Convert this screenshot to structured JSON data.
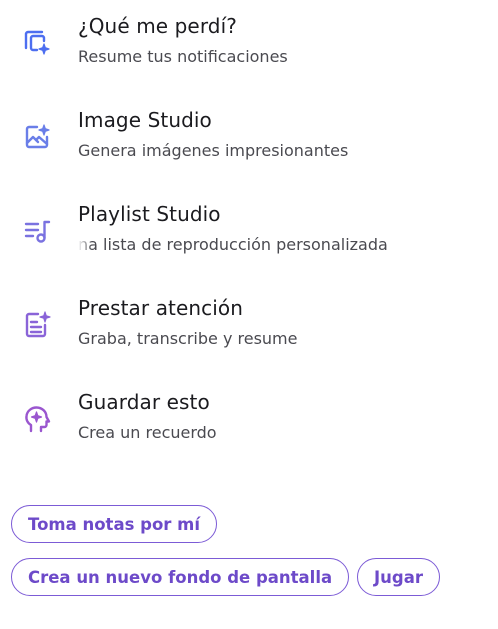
{
  "menu": {
    "items": [
      {
        "title": "¿Qué me perdí?",
        "subtitle": "Resume tus notificaciones",
        "icon": "notifications-summary-icon",
        "color": "#4d6ef0"
      },
      {
        "title": "Image Studio",
        "subtitle": "Genera imágenes impresionantes",
        "icon": "image-sparkle-icon",
        "color": "#6a7ee8"
      },
      {
        "title": "Playlist Studio",
        "subtitle": "na lista de reproducción personalizada",
        "icon": "playlist-icon",
        "color": "#7a72e0"
      },
      {
        "title": "Prestar atención",
        "subtitle": "Graba, transcribe y resume",
        "icon": "notes-sparkle-icon",
        "color": "#8a64d8"
      },
      {
        "title": "Guardar esto",
        "subtitle": "Crea un recuerdo",
        "icon": "memory-head-icon",
        "color": "#9a56cf"
      }
    ]
  },
  "suggestions": {
    "chips": [
      {
        "label": "Toma notas por mí"
      },
      {
        "label": "Crea un nuevo fondo de pantalla"
      },
      {
        "label": "Jugar"
      }
    ]
  },
  "colors": {
    "accent": "#7c5bd6",
    "chip_text": "#6d4ac9",
    "title_text": "#1b1b1f",
    "subtitle_text": "#4a4a50"
  }
}
